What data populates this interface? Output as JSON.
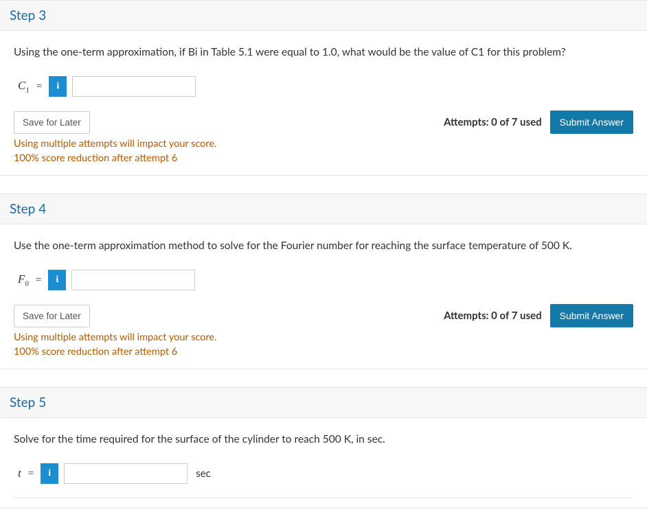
{
  "common": {
    "info_glyph": "i",
    "save_label": "Save for Later",
    "submit_label": "Submit Answer",
    "attempts_text": "Attempts: 0 of 7 used",
    "warn_line1": "Using multiple attempts will impact your score.",
    "warn_line2": "100% score reduction after attempt 6"
  },
  "steps": [
    {
      "title": "Step 3",
      "prompt": "Using the one-term approximation, if Bi in Table 5.1 were equal to 1.0, what would be the value of C1 for this problem?",
      "var_html": "C<sub>1</sub>",
      "eq": "=",
      "unit": "",
      "show_actions": true
    },
    {
      "title": "Step 4",
      "prompt": "Use the one-term approximation method to solve for the Fourier number for reaching the surface temperature of 500 K.",
      "var_html": "F<sub>0</sub>",
      "eq": "=",
      "unit": "",
      "show_actions": true
    },
    {
      "title": "Step 5",
      "prompt": "Solve for the time required for the surface of the cylinder to reach 500 K, in sec.",
      "var_html": "t",
      "eq": "=",
      "unit": "sec",
      "show_actions": false
    }
  ]
}
